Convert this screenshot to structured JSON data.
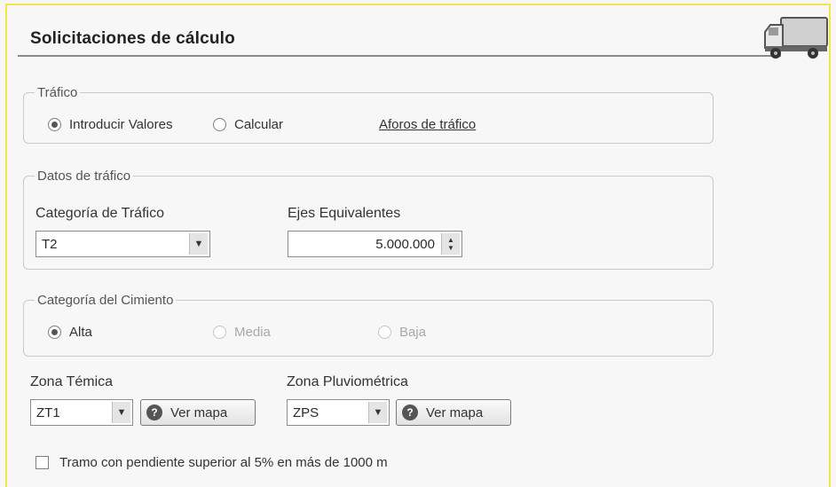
{
  "header": {
    "title": "Solicitaciones de cálculo",
    "icon": "truck-icon"
  },
  "trafico": {
    "legend": "Tráfico",
    "options": [
      {
        "label": "Introducir Valores",
        "selected": true
      },
      {
        "label": "Calcular",
        "selected": false
      }
    ],
    "link": "Aforos de tráfico"
  },
  "datos": {
    "legend": "Datos de tráfico",
    "categoria_label": "Categoría de Tráfico",
    "categoria_value": "T2",
    "ejes_label": "Ejes Equivalentes",
    "ejes_value": "5.000.000"
  },
  "cimiento": {
    "legend": "Categoría del Cimiento",
    "options": [
      {
        "label": "Alta",
        "selected": true,
        "enabled": true
      },
      {
        "label": "Media",
        "selected": false,
        "enabled": false
      },
      {
        "label": "Baja",
        "selected": false,
        "enabled": false
      }
    ]
  },
  "zona_termica": {
    "label": "Zona Témica",
    "value": "ZT1",
    "button": "Ver mapa"
  },
  "zona_pluvio": {
    "label": "Zona Pluviométrica",
    "value": "ZPS",
    "button": "Ver mapa"
  },
  "pendiente": {
    "label": "Tramo con pendiente superior al 5% en más de 1000 m",
    "checked": false
  },
  "colors": {
    "frame_accent": "#f2e54a",
    "title_rule": "#8a8a8a"
  }
}
